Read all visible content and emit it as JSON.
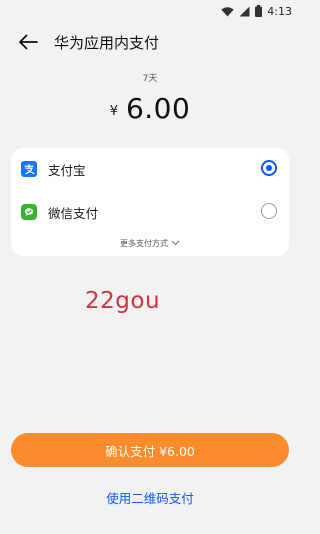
{
  "status_bar": {
    "time": "4:13"
  },
  "header": {
    "title": "华为应用内支付"
  },
  "product": {
    "duration": "7天"
  },
  "amount": {
    "currency": "¥",
    "value": "6.00"
  },
  "payment_methods": [
    {
      "label": "支付宝",
      "selected": true
    },
    {
      "label": "微信支付",
      "selected": false
    }
  ],
  "more_methods": {
    "label": "更多支付方式"
  },
  "watermark": {
    "text": "22gou"
  },
  "confirm_button": {
    "label": "确认支付 ¥6.00"
  },
  "qr_link": {
    "label": "使用二维码支付"
  },
  "colors": {
    "accent_blue": "#0a59f7",
    "confirm_orange": "#fa8c2e",
    "alipay_blue": "#1677ff",
    "wechat_green": "#35b12e",
    "watermark_red": "#d6303a"
  }
}
